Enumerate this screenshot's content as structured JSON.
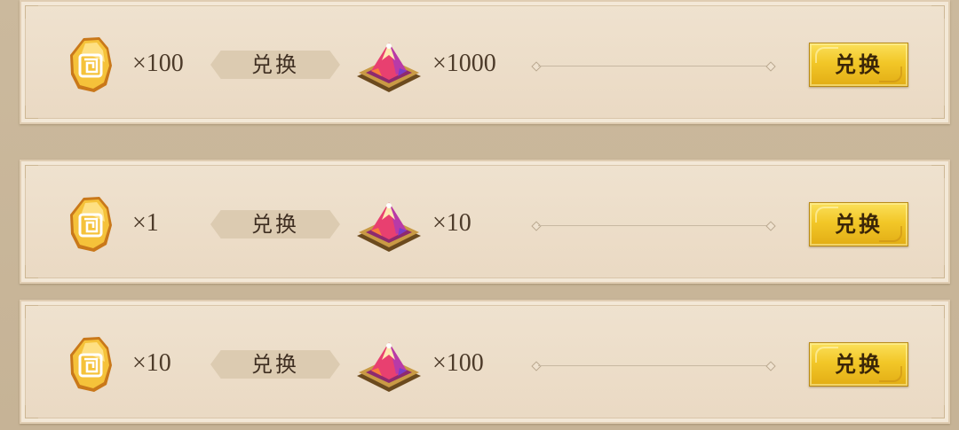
{
  "exchange_rows": [
    {
      "cost_item": "gold-spiral-token-icon",
      "cost_qty": "×1",
      "label": "兑换",
      "reward_item": "magic-crystal-tray-icon",
      "reward_qty": "×10",
      "button_label": "兑换"
    },
    {
      "cost_item": "gold-spiral-token-icon",
      "cost_qty": "×10",
      "label": "兑换",
      "reward_item": "magic-crystal-tray-icon",
      "reward_qty": "×100",
      "button_label": "兑换"
    },
    {
      "cost_item": "gold-spiral-token-icon",
      "cost_qty": "×100",
      "label": "兑换",
      "reward_item": "magic-crystal-tray-icon",
      "reward_qty": "×1000",
      "button_label": "兑换"
    }
  ],
  "colors": {
    "background": "#c9b79b",
    "panel": "#ecdec9",
    "button_gold": "#f2c728",
    "text": "#4d3b2a"
  }
}
